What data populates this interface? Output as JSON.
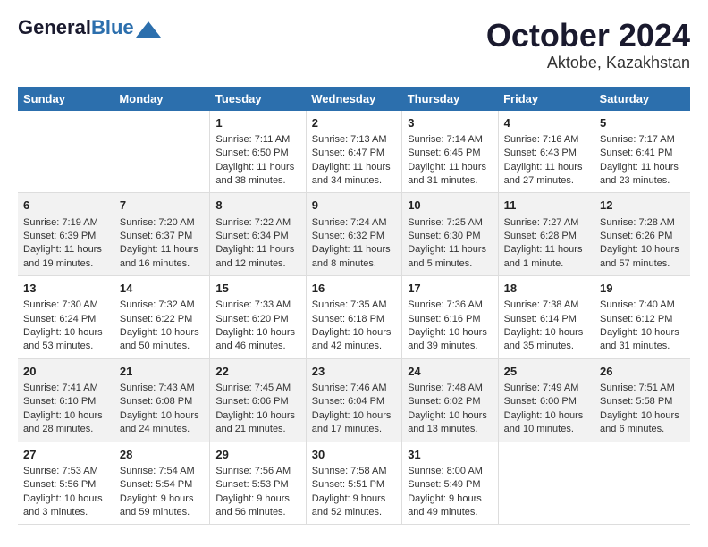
{
  "header": {
    "logo_general": "General",
    "logo_blue": "Blue",
    "month_title": "October 2024",
    "location": "Aktobe, Kazakhstan"
  },
  "days_of_week": [
    "Sunday",
    "Monday",
    "Tuesday",
    "Wednesday",
    "Thursday",
    "Friday",
    "Saturday"
  ],
  "weeks": [
    [
      {
        "day": "",
        "info": ""
      },
      {
        "day": "",
        "info": ""
      },
      {
        "day": "1",
        "info": "Sunrise: 7:11 AM\nSunset: 6:50 PM\nDaylight: 11 hours and 38 minutes."
      },
      {
        "day": "2",
        "info": "Sunrise: 7:13 AM\nSunset: 6:47 PM\nDaylight: 11 hours and 34 minutes."
      },
      {
        "day": "3",
        "info": "Sunrise: 7:14 AM\nSunset: 6:45 PM\nDaylight: 11 hours and 31 minutes."
      },
      {
        "day": "4",
        "info": "Sunrise: 7:16 AM\nSunset: 6:43 PM\nDaylight: 11 hours and 27 minutes."
      },
      {
        "day": "5",
        "info": "Sunrise: 7:17 AM\nSunset: 6:41 PM\nDaylight: 11 hours and 23 minutes."
      }
    ],
    [
      {
        "day": "6",
        "info": "Sunrise: 7:19 AM\nSunset: 6:39 PM\nDaylight: 11 hours and 19 minutes."
      },
      {
        "day": "7",
        "info": "Sunrise: 7:20 AM\nSunset: 6:37 PM\nDaylight: 11 hours and 16 minutes."
      },
      {
        "day": "8",
        "info": "Sunrise: 7:22 AM\nSunset: 6:34 PM\nDaylight: 11 hours and 12 minutes."
      },
      {
        "day": "9",
        "info": "Sunrise: 7:24 AM\nSunset: 6:32 PM\nDaylight: 11 hours and 8 minutes."
      },
      {
        "day": "10",
        "info": "Sunrise: 7:25 AM\nSunset: 6:30 PM\nDaylight: 11 hours and 5 minutes."
      },
      {
        "day": "11",
        "info": "Sunrise: 7:27 AM\nSunset: 6:28 PM\nDaylight: 11 hours and 1 minute."
      },
      {
        "day": "12",
        "info": "Sunrise: 7:28 AM\nSunset: 6:26 PM\nDaylight: 10 hours and 57 minutes."
      }
    ],
    [
      {
        "day": "13",
        "info": "Sunrise: 7:30 AM\nSunset: 6:24 PM\nDaylight: 10 hours and 53 minutes."
      },
      {
        "day": "14",
        "info": "Sunrise: 7:32 AM\nSunset: 6:22 PM\nDaylight: 10 hours and 50 minutes."
      },
      {
        "day": "15",
        "info": "Sunrise: 7:33 AM\nSunset: 6:20 PM\nDaylight: 10 hours and 46 minutes."
      },
      {
        "day": "16",
        "info": "Sunrise: 7:35 AM\nSunset: 6:18 PM\nDaylight: 10 hours and 42 minutes."
      },
      {
        "day": "17",
        "info": "Sunrise: 7:36 AM\nSunset: 6:16 PM\nDaylight: 10 hours and 39 minutes."
      },
      {
        "day": "18",
        "info": "Sunrise: 7:38 AM\nSunset: 6:14 PM\nDaylight: 10 hours and 35 minutes."
      },
      {
        "day": "19",
        "info": "Sunrise: 7:40 AM\nSunset: 6:12 PM\nDaylight: 10 hours and 31 minutes."
      }
    ],
    [
      {
        "day": "20",
        "info": "Sunrise: 7:41 AM\nSunset: 6:10 PM\nDaylight: 10 hours and 28 minutes."
      },
      {
        "day": "21",
        "info": "Sunrise: 7:43 AM\nSunset: 6:08 PM\nDaylight: 10 hours and 24 minutes."
      },
      {
        "day": "22",
        "info": "Sunrise: 7:45 AM\nSunset: 6:06 PM\nDaylight: 10 hours and 21 minutes."
      },
      {
        "day": "23",
        "info": "Sunrise: 7:46 AM\nSunset: 6:04 PM\nDaylight: 10 hours and 17 minutes."
      },
      {
        "day": "24",
        "info": "Sunrise: 7:48 AM\nSunset: 6:02 PM\nDaylight: 10 hours and 13 minutes."
      },
      {
        "day": "25",
        "info": "Sunrise: 7:49 AM\nSunset: 6:00 PM\nDaylight: 10 hours and 10 minutes."
      },
      {
        "day": "26",
        "info": "Sunrise: 7:51 AM\nSunset: 5:58 PM\nDaylight: 10 hours and 6 minutes."
      }
    ],
    [
      {
        "day": "27",
        "info": "Sunrise: 7:53 AM\nSunset: 5:56 PM\nDaylight: 10 hours and 3 minutes."
      },
      {
        "day": "28",
        "info": "Sunrise: 7:54 AM\nSunset: 5:54 PM\nDaylight: 9 hours and 59 minutes."
      },
      {
        "day": "29",
        "info": "Sunrise: 7:56 AM\nSunset: 5:53 PM\nDaylight: 9 hours and 56 minutes."
      },
      {
        "day": "30",
        "info": "Sunrise: 7:58 AM\nSunset: 5:51 PM\nDaylight: 9 hours and 52 minutes."
      },
      {
        "day": "31",
        "info": "Sunrise: 8:00 AM\nSunset: 5:49 PM\nDaylight: 9 hours and 49 minutes."
      },
      {
        "day": "",
        "info": ""
      },
      {
        "day": "",
        "info": ""
      }
    ]
  ]
}
